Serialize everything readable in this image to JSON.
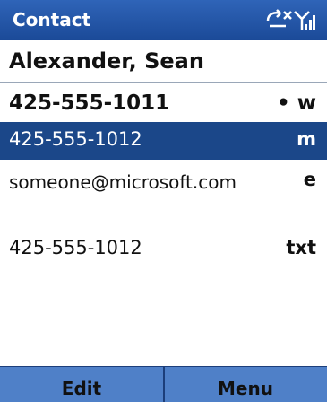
{
  "titlebar": {
    "title": "Contact",
    "icons": [
      "sync-x-icon",
      "signal-strength-icon"
    ]
  },
  "contact": {
    "name": "Alexander, Sean"
  },
  "rows": [
    {
      "value": "425-555-1011",
      "tag": "• w",
      "selected": false,
      "default": true
    },
    {
      "value": "425-555-1012",
      "tag": "m",
      "selected": true
    },
    {
      "value": "someone@microsoft.com",
      "tag": "e",
      "selected": false
    },
    {
      "value": "425-555-1012",
      "tag": "txt",
      "selected": false
    }
  ],
  "softkeys": {
    "left": "Edit",
    "right": "Menu"
  },
  "colors": {
    "titlebar": "#1b4a98",
    "selection": "#1b4789",
    "softkeys": "#4f80c8"
  }
}
